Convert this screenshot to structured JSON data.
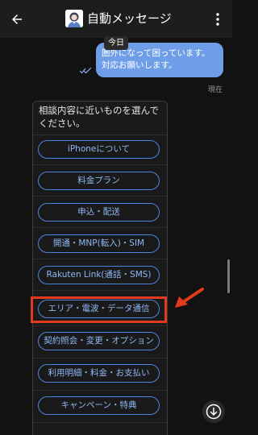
{
  "header": {
    "title": "自動メッセージ",
    "back_icon": "arrow-back-icon",
    "more_icon": "more-vert-icon",
    "avatar": "avatar"
  },
  "conversation": {
    "date_chip": "今日",
    "sent_message": "圏外になって困っています。\n対応お願いします。",
    "timestamp": "現在",
    "read_status_icon": "double-check-icon"
  },
  "bot": {
    "prompt": "相談内容に近いものを選んで\nください。",
    "choices": [
      "iPhoneについて",
      "料金プラン",
      "申込・配送",
      "開通・MNP(転入)・SIM",
      "Rakuten Link(通話・SMS)",
      "エリア・電波・データ通信",
      "契約照会・変更・オプション",
      "利用明細・料金・お支払い",
      "キャンペーン・特典"
    ]
  },
  "annotation": {
    "highlight_color": "#e23a1f",
    "highlighted_choice": "エリア・電波・データ通信"
  },
  "colors": {
    "background": "#121212",
    "header": "#1d1d1d",
    "sent_bubble": "#6f9ee9",
    "choice_border": "#4b84df",
    "choice_text": "#8fb8f5"
  }
}
